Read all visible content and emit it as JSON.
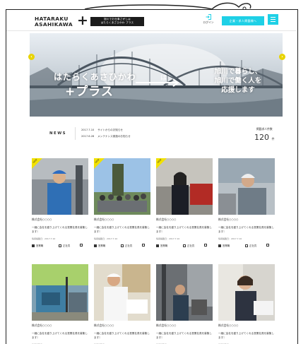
{
  "header": {
    "logo_line1": "HATARAKU",
    "logo_line2": "ASAHIKAWA",
    "logo_plus": "+",
    "logo_sub_line1": "旭川でお仕事さがしは",
    "logo_sub_line2": "はたらくあさひかわ プラス",
    "login_label": "ログイン",
    "cta_label": "企業・求人掲載様へ",
    "accent": "#1ed0e6"
  },
  "hero": {
    "title_line1": "はたらくあさひかわ",
    "title_line2": "+プラス",
    "connector": "は",
    "message_lines": [
      "旭川で暮らし、",
      "旭川で働く人を",
      "応援します"
    ],
    "arrow_color": "#e8d300"
  },
  "news": {
    "label": "NEWS",
    "items": [
      {
        "date": "2017.7.10",
        "text": "サイトからのお知らせ"
      },
      {
        "date": "2017.6.28",
        "text": "メンテナンス実施のお知らせ"
      }
    ],
    "count_label": "掲載求人件数",
    "count_value": "120",
    "count_unit": "件"
  },
  "cards": [
    {
      "badge": "NEW",
      "company": "株式会社○○○○",
      "desc": "一緒に会社を盛り上げてくれる営業社員を募集します！",
      "meta": "情報掲載日：2017.7.10",
      "act1": "営業職",
      "act2": "正社員"
    },
    {
      "badge": "NEW",
      "company": "株式会社○○○○",
      "desc": "一緒に会社を盛り上げてくれる営業社員を募集します！",
      "meta": "情報掲載日：2017.7.10",
      "act1": "営業職",
      "act2": "正社員"
    },
    {
      "badge": "NEW",
      "company": "株式会社○○○○",
      "desc": "一緒に会社を盛り上げてくれる営業社員を募集します！",
      "meta": "情報掲載日：2017.7.10",
      "act1": "営業職",
      "act2": "正社員"
    },
    {
      "badge": "",
      "company": "株式会社○○○○",
      "desc": "一緒に会社を盛り上げてくれる営業社員を募集します！",
      "meta": "情報掲載日：2017.7.10",
      "act1": "営業職",
      "act2": "正社員"
    },
    {
      "badge": "",
      "company": "株式会社○○○○",
      "desc": "一緒に会社を盛り上げてくれる営業社員を募集します！",
      "meta": "情報掲載日：2017.7.10",
      "act1": "営業職",
      "act2": "正社員"
    },
    {
      "badge": "",
      "company": "株式会社○○○○",
      "desc": "一緒に会社を盛り上げてくれる営業社員を募集します！",
      "meta": "情報掲載日：2017.7.10",
      "act1": "営業職",
      "act2": "正社員"
    },
    {
      "badge": "",
      "company": "株式会社○○○○",
      "desc": "一緒に会社を盛り上げてくれる営業社員を募集します！",
      "meta": "情報掲載日：2017.7.10",
      "act1": "営業職",
      "act2": "正社員"
    },
    {
      "badge": "",
      "company": "株式会社○○○○",
      "desc": "一緒に会社を盛り上げてくれる営業社員を募集します！",
      "meta": "情報掲載日：2017.7.10",
      "act1": "営業職",
      "act2": "正社員"
    }
  ]
}
